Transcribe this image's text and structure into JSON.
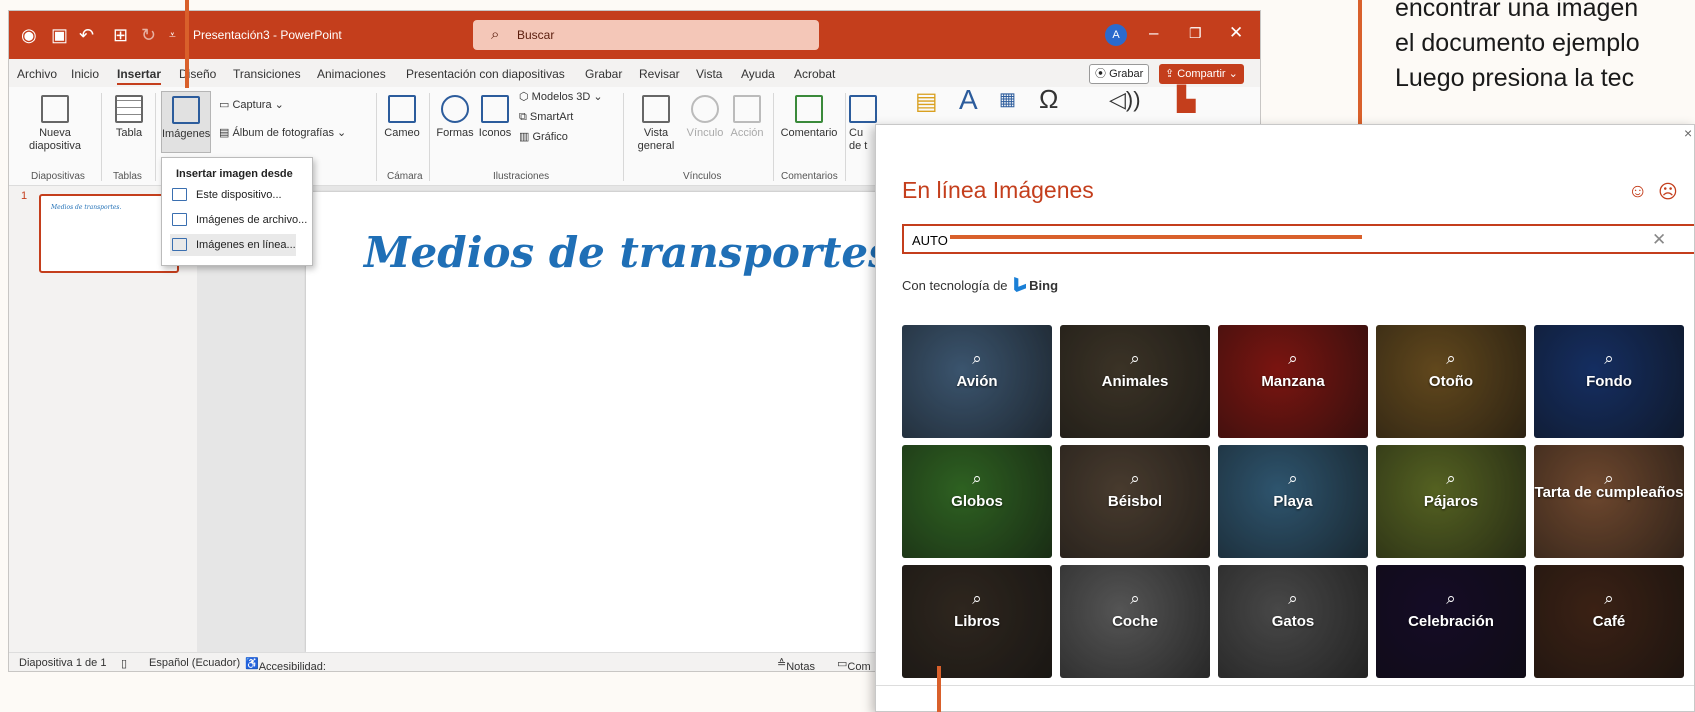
{
  "tutorial": {
    "lines": [
      "encontrar una imagen",
      "el documento ejemplo",
      "Luego presiona la tec"
    ]
  },
  "window": {
    "title": "Presentación3  -  PowerPoint",
    "search_placeholder": "Buscar",
    "user_initial": "A",
    "brand_color": "#c43e1c"
  },
  "menu": {
    "tabs": [
      "Archivo",
      "Inicio",
      "Insertar",
      "Diseño",
      "Transiciones",
      "Animaciones",
      "Presentación con diapositivas",
      "Grabar",
      "Revisar",
      "Vista",
      "Ayuda",
      "Acrobat"
    ],
    "active_tab": "Insertar",
    "record_label": "Grabar",
    "share_label": "Compartir"
  },
  "ribbon": {
    "new_slide": "Nueva diapositiva",
    "table": "Tabla",
    "images": "Imágenes",
    "capture": "Captura",
    "album": "Álbum de fotografías",
    "cameo": "Cameo",
    "shapes": "Formas",
    "icons": "Iconos",
    "models3d": "Modelos 3D",
    "smartart": "SmartArt",
    "chart": "Gráfico",
    "overview": "Vista general",
    "link": "Vínculo",
    "action": "Acción",
    "comment": "Comentario",
    "textbox_partial": "Cu",
    "textbox_partial2": "de t",
    "groups": {
      "slides": "Diapositivas",
      "tables": "Tablas",
      "camera": "Cámara",
      "illustrations": "Ilustraciones",
      "links": "Vínculos",
      "comments": "Comentarios"
    }
  },
  "dropdown": {
    "header": "Insertar imagen desde",
    "items": [
      "Este dispositivo...",
      "Imágenes de archivo...",
      "Imágenes en línea..."
    ]
  },
  "slide": {
    "number": "1",
    "title": "Medios de transportes.",
    "thumb_title": "Medios de transportes."
  },
  "status": {
    "slide_count": "Diapositiva 1 de 1",
    "language": "Español (Ecuador)",
    "accessibility": "Accesibilidad: todo correcto",
    "notes": "Notas",
    "comments_partial": "Com"
  },
  "dialog": {
    "title": "En línea Imágenes",
    "search_value": "AUTO",
    "powered_prefix": "Con tecnología de",
    "powered_brand": "Bing",
    "categories": [
      {
        "label": "Avión",
        "color": "#4a6a8a"
      },
      {
        "label": "Animales",
        "color": "#4a4030"
      },
      {
        "label": "Manzana",
        "color": "#9a1a14"
      },
      {
        "label": "Otoño",
        "color": "#7a5a24"
      },
      {
        "label": "Fondo",
        "color": "#1a3a7a"
      },
      {
        "label": "Globos",
        "color": "#3a7a2a"
      },
      {
        "label": "Béisbol",
        "color": "#5a4a3a"
      },
      {
        "label": "Playa",
        "color": "#3a6a8a"
      },
      {
        "label": "Pájaros",
        "color": "#6a7a2a"
      },
      {
        "label": "Tarta de cumpleaños",
        "color": "#8a5a3a"
      },
      {
        "label": "Libros",
        "color": "#3a3026"
      },
      {
        "label": "Coche",
        "color": "#6a6a6a"
      },
      {
        "label": "Gatos",
        "color": "#5a5a5a"
      },
      {
        "label": "Celebración",
        "color": "#1a1030"
      },
      {
        "label": "Café",
        "color": "#4a2a1a"
      }
    ]
  }
}
